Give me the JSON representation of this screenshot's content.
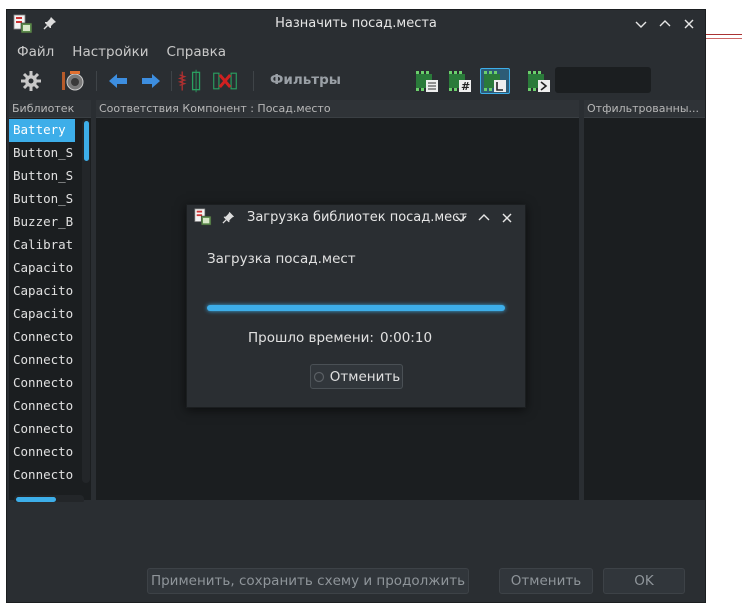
{
  "window": {
    "title": "Назначить посад.места"
  },
  "menu": {
    "items": [
      "Файл",
      "Настройки",
      "Справка"
    ]
  },
  "toolbar": {
    "filters_label": "Фильтры",
    "filter_input_value": ""
  },
  "panes": {
    "libraries_header": "Библиотек",
    "components_header": "Соответствия Компонент : Посад.место",
    "filtered_header": "Отфильтрованны..."
  },
  "libraries": [
    "Battery",
    "Button_S",
    "Button_S",
    "Button_S",
    "Buzzer_B",
    "Calibrat",
    "Capacito",
    "Capacito",
    "Capacito",
    "Connecto",
    "Connecto",
    "Connecto",
    "Connecto",
    "Connecto",
    "Connecto",
    "Connecto"
  ],
  "bottom": {
    "apply_label": "Применить, сохранить схему и продолжить",
    "cancel_label": "Отменить",
    "ok_label": "OK"
  },
  "dialog": {
    "title": "Загрузка библиотек посад.мест",
    "message": "Загрузка посад.мест",
    "progress": 1.0,
    "elapsed_label": "Прошло времени:",
    "elapsed_value": "0:00:10",
    "cancel_label": "Отменить"
  },
  "colors": {
    "accent": "#3daee9",
    "window_bg": "#2a2e32",
    "pane_bg": "#1b1e20"
  }
}
